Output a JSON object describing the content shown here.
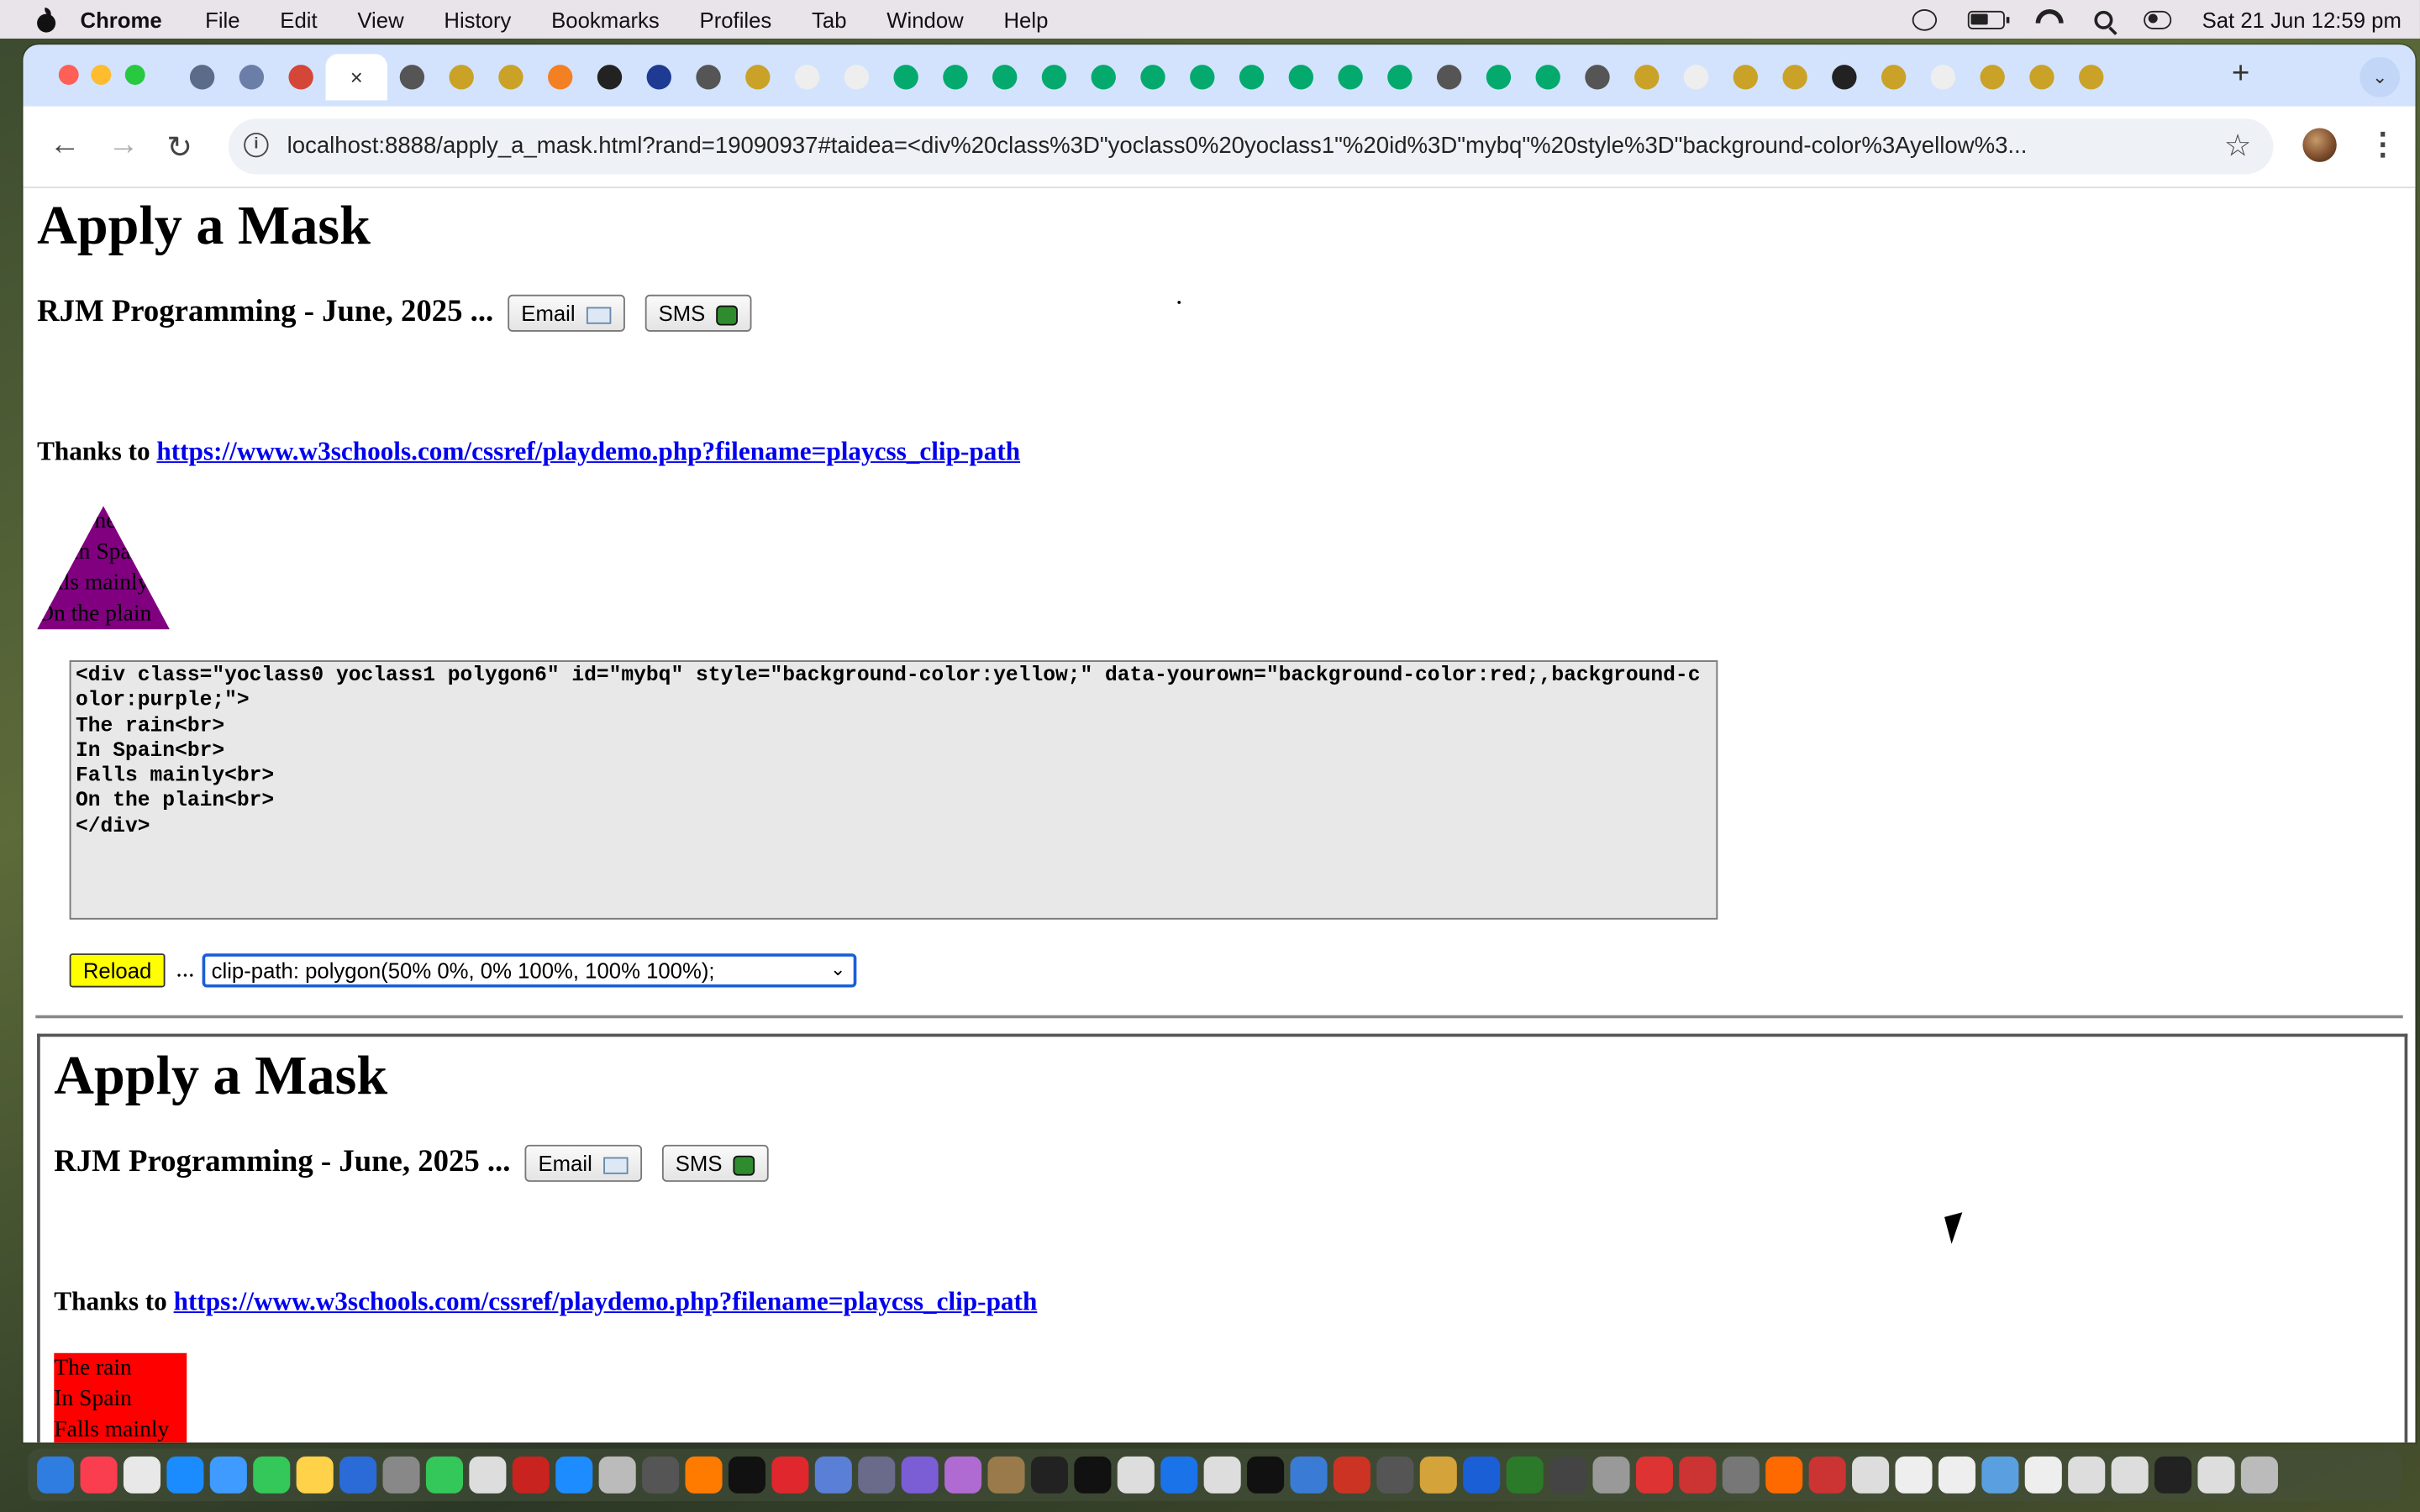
{
  "menubar": {
    "app": "Chrome",
    "items": [
      "File",
      "Edit",
      "View",
      "History",
      "Bookmarks",
      "Profiles",
      "Tab",
      "Window",
      "Help"
    ],
    "datetime": "Sat 21 Jun  12:59 pm"
  },
  "browser": {
    "active_tab_close": "×",
    "new_tab": "+",
    "url": "localhost:8888/apply_a_mask.html?rand=19090937#taidea=<div%20class%3D\"yoclass0%20yoclass1\"%20id%3D\"mybq\"%20style%3D\"background-color%3Ayellow%3..."
  },
  "page": {
    "title": "Apply a Mask",
    "subtitle": "RJM Programming - June, 2025 ...",
    "email_button": "Email",
    "sms_button": "SMS",
    "thanks_prefix": "Thanks to",
    "thanks_link": "https://www.w3schools.com/cssref/playdemo.php?filename=playcss_clip-path",
    "poem": [
      "The rain",
      "In Spain",
      "Falls mainly",
      "On the plain"
    ],
    "textarea": "<div class=\"yoclass0 yoclass1 polygon6\" id=\"mybq\" style=\"background-color:yellow;\" data-yourown=\"background-color:red;,background-color:purple;\">\nThe rain<br>\nIn Spain<br>\nFalls mainly<br>\nOn the plain<br>\n</div>",
    "reload_button": "Reload",
    "ellipsis": "...",
    "select_value": "clip-path: polygon(50% 0%, 0% 100%, 100% 100%);"
  },
  "colors": {
    "tabstrip": "#d3e3fd",
    "triangle": "#800080",
    "reload": "#ffff00",
    "redbox": "#ff0000",
    "link": "#0000ee"
  }
}
